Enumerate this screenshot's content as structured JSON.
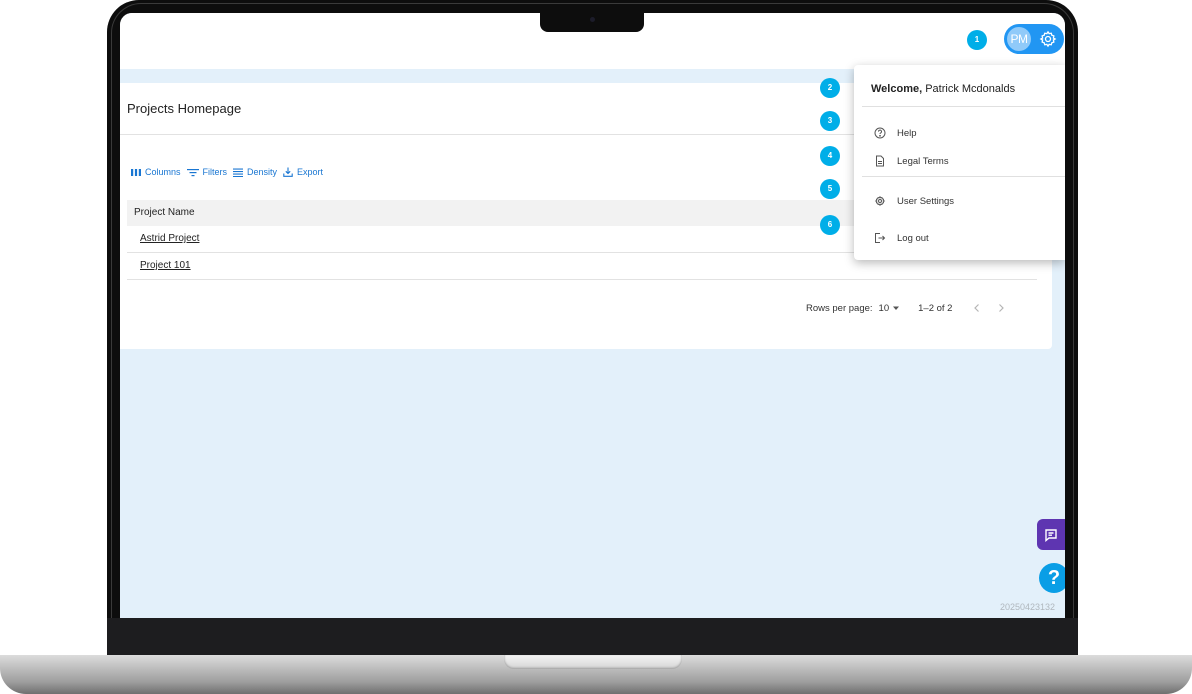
{
  "header": {
    "avatar_initials": "PM",
    "settings_icon": "gear-icon",
    "accent_color": "#2196f3"
  },
  "page": {
    "title": "Projects Homepage"
  },
  "toolbar": {
    "columns_label": "Columns",
    "filters_label": "Filters",
    "density_label": "Density",
    "export_label": "Export",
    "accent_color": "#1976d2"
  },
  "grid": {
    "column_header": "Project Name",
    "rows": [
      {
        "project_name": "Astrid Project"
      },
      {
        "project_name": "Project 101"
      }
    ]
  },
  "pagination": {
    "rows_per_page_label": "Rows per page:",
    "rows_per_page_value": "10",
    "range_label": "1–2 of 2"
  },
  "user_menu": {
    "welcome_prefix": "Welcome,",
    "user_name": "Patrick Mcdonalds",
    "items": [
      {
        "label": "Help",
        "icon": "help-circle-icon"
      },
      {
        "label": "Legal Terms",
        "icon": "document-icon"
      },
      {
        "label": "User Settings",
        "icon": "gear-icon"
      },
      {
        "label": "Log out",
        "icon": "logout-icon"
      }
    ]
  },
  "step_badges": [
    "1",
    "2",
    "3",
    "4",
    "5",
    "6"
  ],
  "badge_color": "#00aee8",
  "floating": {
    "help_label": "?",
    "feedback_icon": "chat-icon",
    "feedback_color": "#5e35b1",
    "version_text": "20250423132"
  }
}
